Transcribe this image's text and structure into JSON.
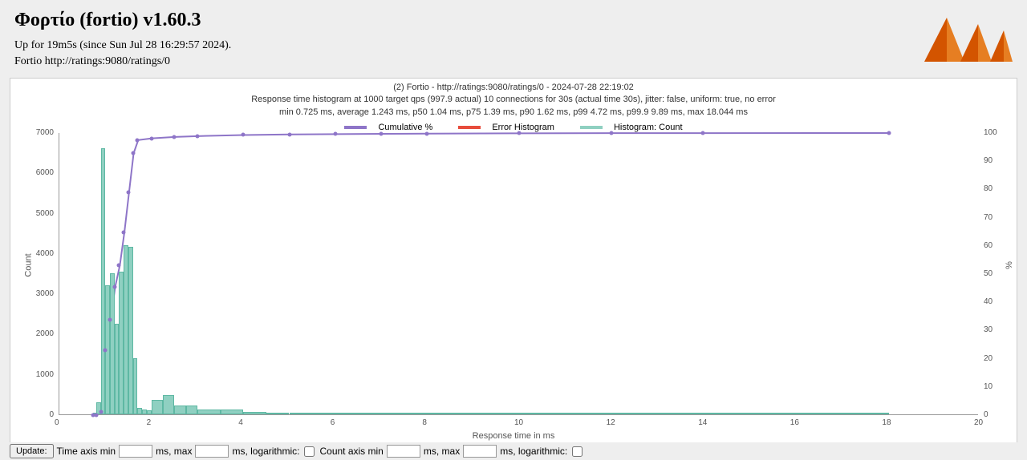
{
  "header": {
    "title": "Φορτίο (fortio) v1.60.3",
    "uptime": "Up for 19m5s (since Sun Jul 28 16:29:57 2024).",
    "target": "Fortio http://ratings:9080/ratings/0"
  },
  "chart_data": {
    "type": "bar+line",
    "title_line1": "(2) Fortio - http://ratings:9080/ratings/0 - 2024-07-28 22:19:02",
    "title_line2": "Response time histogram at 1000 target qps (997.9 actual) 10 connections for 30s (actual time 30s), jitter: false, uniform: true, no error",
    "title_line3": "min 0.725 ms, average 1.243 ms, p50 1.04 ms, p75 1.39 ms, p90 1.62 ms, p99 4.72 ms, p99.9 9.89 ms, max 18.044 ms",
    "xlabel": "Response time in ms",
    "ylabel_left": "Count",
    "ylabel_right": "%",
    "x_ticks": [
      0,
      2,
      4,
      6,
      8,
      10,
      12,
      14,
      16,
      18,
      20
    ],
    "y_left_ticks": [
      0,
      1000,
      2000,
      3000,
      4000,
      5000,
      6000,
      7000
    ],
    "y_right_ticks": [
      0,
      10,
      20,
      30,
      40,
      50,
      60,
      70,
      80,
      90,
      100
    ],
    "x_max": 20,
    "y_left_max": 7000,
    "y_right_max": 100,
    "legend": [
      {
        "name": "Cumulative %",
        "color": "#8e75c8"
      },
      {
        "name": "Error Histogram",
        "color": "#e74c3c"
      },
      {
        "name": "Histogram: Count",
        "color": "#8fd0c1"
      }
    ],
    "histogram": [
      {
        "x": 0.725,
        "w": 0.075,
        "count": 10
      },
      {
        "x": 0.8,
        "w": 0.1,
        "count": 300
      },
      {
        "x": 0.9,
        "w": 0.1,
        "count": 6600
      },
      {
        "x": 1.0,
        "w": 0.1,
        "count": 3200
      },
      {
        "x": 1.1,
        "w": 0.1,
        "count": 3500
      },
      {
        "x": 1.2,
        "w": 0.1,
        "count": 2250
      },
      {
        "x": 1.3,
        "w": 0.1,
        "count": 3550
      },
      {
        "x": 1.4,
        "w": 0.1,
        "count": 4200
      },
      {
        "x": 1.5,
        "w": 0.1,
        "count": 4150
      },
      {
        "x": 1.6,
        "w": 0.1,
        "count": 1400
      },
      {
        "x": 1.7,
        "w": 0.1,
        "count": 150
      },
      {
        "x": 1.8,
        "w": 0.1,
        "count": 120
      },
      {
        "x": 1.9,
        "w": 0.1,
        "count": 100
      },
      {
        "x": 2.0,
        "w": 0.25,
        "count": 350
      },
      {
        "x": 2.25,
        "w": 0.25,
        "count": 480
      },
      {
        "x": 2.5,
        "w": 0.25,
        "count": 220
      },
      {
        "x": 2.75,
        "w": 0.25,
        "count": 220
      },
      {
        "x": 3.0,
        "w": 0.5,
        "count": 120
      },
      {
        "x": 3.5,
        "w": 0.5,
        "count": 110
      },
      {
        "x": 4.0,
        "w": 0.5,
        "count": 55
      },
      {
        "x": 4.5,
        "w": 0.5,
        "count": 40
      },
      {
        "x": 5.0,
        "w": 1.0,
        "count": 40
      },
      {
        "x": 6.0,
        "w": 1.0,
        "count": 30
      },
      {
        "x": 7.0,
        "w": 1.0,
        "count": 20
      },
      {
        "x": 8.0,
        "w": 2.0,
        "count": 18
      },
      {
        "x": 10.0,
        "w": 2.0,
        "count": 10
      },
      {
        "x": 12.0,
        "w": 2.0,
        "count": 5
      },
      {
        "x": 14.0,
        "w": 4.044,
        "count": 3
      }
    ],
    "cumulative": [
      {
        "x": 0.725,
        "pct": 0
      },
      {
        "x": 0.8,
        "pct": 0.03
      },
      {
        "x": 0.9,
        "pct": 1.03
      },
      {
        "x": 1.0,
        "pct": 23.1
      },
      {
        "x": 1.1,
        "pct": 33.8
      },
      {
        "x": 1.2,
        "pct": 45.5
      },
      {
        "x": 1.3,
        "pct": 53.0
      },
      {
        "x": 1.4,
        "pct": 64.9
      },
      {
        "x": 1.5,
        "pct": 78.9
      },
      {
        "x": 1.6,
        "pct": 92.8
      },
      {
        "x": 1.7,
        "pct": 97.5
      },
      {
        "x": 2.0,
        "pct": 98.1
      },
      {
        "x": 2.5,
        "pct": 98.6
      },
      {
        "x": 3.0,
        "pct": 98.9
      },
      {
        "x": 4.0,
        "pct": 99.3
      },
      {
        "x": 5.0,
        "pct": 99.5
      },
      {
        "x": 6.0,
        "pct": 99.6
      },
      {
        "x": 7.0,
        "pct": 99.7
      },
      {
        "x": 8.0,
        "pct": 99.8
      },
      {
        "x": 10.0,
        "pct": 99.9
      },
      {
        "x": 12.0,
        "pct": 99.95
      },
      {
        "x": 14.0,
        "pct": 99.98
      },
      {
        "x": 18.044,
        "pct": 100
      }
    ]
  },
  "controls": {
    "update_btn": "Update:",
    "time_axis_min_label": "Time axis min",
    "ms_max_label": "ms, max",
    "ms_log_label": "ms, logarithmic:",
    "count_axis_min_label": "Count axis min",
    "ms_max2_label": "ms, max",
    "ms_log2_label": "ms, logarithmic:"
  },
  "colors": {
    "accent_purple": "#8e75c8",
    "accent_orange": "#e67e22",
    "accent_teal": "#8fd0c1"
  }
}
